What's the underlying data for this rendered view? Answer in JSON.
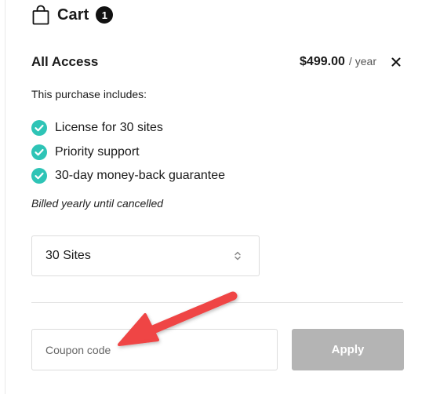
{
  "cart": {
    "title": "Cart",
    "count": "1",
    "bag_icon": "shopping-bag-icon"
  },
  "item": {
    "name": "All Access",
    "price": "$499.00",
    "separator": "/",
    "period": "year",
    "remove_icon": "close-icon",
    "includes_heading": "This purchase includes:",
    "features": [
      {
        "label": "License for 30 sites",
        "icon": "check-circle-icon"
      },
      {
        "label": "Priority support",
        "icon": "check-circle-icon"
      },
      {
        "label": "30-day money-back guarantee",
        "icon": "check-circle-icon"
      }
    ],
    "billing_note": "Billed yearly until cancelled"
  },
  "sites_select": {
    "selected": "30 Sites",
    "icon": "select-arrows-icon"
  },
  "coupon": {
    "placeholder": "Coupon code",
    "value": "",
    "apply_label": "Apply"
  },
  "colors": {
    "check": "#2ec4b6",
    "apply_button": "#b4b4b4",
    "annotation_arrow": "#ef4444"
  }
}
